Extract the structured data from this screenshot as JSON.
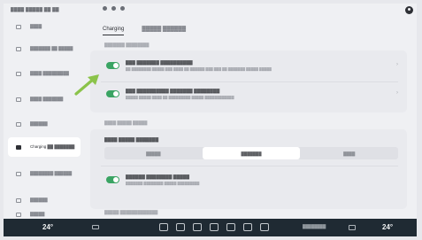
{
  "status_bar": {
    "left_text": "▓▓▓▓ ▓▓▓▓▓ ▓▓ ▓▓"
  },
  "sidebar": {
    "items": [
      {
        "label": "▓▓▓▓"
      },
      {
        "label": "▓▓▓▓▓▓▓ ▓▓ ▓▓▓▓▓"
      },
      {
        "label": "▓▓▓▓ ▓▓▓▓▓▓▓▓▓"
      },
      {
        "label": "▓▓▓▓ ▓▓▓▓▓▓▓"
      },
      {
        "label": "▓▓▓▓▓▓"
      },
      {
        "label": "Charging ▓▓ ▓▓▓▓▓▓▓"
      },
      {
        "label": "▓▓▓▓▓▓▓▓ ▓▓▓▓▓▓"
      },
      {
        "label": "▓▓▓▓▓▓"
      },
      {
        "label": "▓▓▓▓▓"
      }
    ],
    "active_index": 5
  },
  "tabs": [
    {
      "label": "Charging",
      "active": true
    },
    {
      "label": "▓▓▓▓▓ ▓▓▓▓▓▓",
      "active": false
    }
  ],
  "section1_label": "▓▓▓▓▓▓▓ ▓▓▓▓▓▓▓▓",
  "toggle_rows": [
    {
      "title": "▓▓▓ ▓▓▓▓▓▓▓ ▓▓▓▓▓▓▓▓▓▓",
      "subtitle": "▓▓ ▓▓▓▓▓▓▓▓ ▓▓▓▓▓ ▓▓▓ ▓▓▓▓ ▓▓ ▓▓▓▓▓▓ ▓▓▓ ▓▓▓ ▓▓ ▓▓▓▓▓▓▓ ▓▓▓▓▓ ▓▓▓▓▓",
      "on": true
    },
    {
      "title": "▓▓▓ ▓▓▓▓▓▓▓▓▓▓ ▓▓▓▓▓▓▓ ▓▓▓▓▓▓▓▓",
      "subtitle": "▓▓▓▓▓ ▓▓▓▓▓ ▓▓▓▓ ▓▓ ▓▓▓▓▓▓▓▓▓ ▓▓▓▓▓ ▓▓▓▓▓▓▓▓▓▓▓▓",
      "on": true
    }
  ],
  "section2_label": "▓▓▓▓ ▓▓▓▓▓ ▓▓▓▓▓",
  "seg_title": "▓▓▓▓ ▓▓▓▓▓ ▓▓▓▓▓▓▓",
  "seg_options": [
    {
      "label": "▓▓▓▓▓",
      "selected": false
    },
    {
      "label": "▓▓▓▓▓▓▓",
      "selected": true
    },
    {
      "label": "▓▓▓▓",
      "selected": false
    }
  ],
  "toggle_row3": {
    "title": "▓▓▓▓▓▓ ▓▓▓▓▓▓▓▓ ▓▓▓▓▓",
    "subtitle": "▓▓▓▓▓▓▓ ▓▓▓▓▓▓▓▓ ▓▓▓▓▓ ▓▓▓▓▓▓▓▓▓",
    "on": true
  },
  "footer_note": "▓▓▓▓▓ ▓▓▓▓▓▓▓▓▓▓▓▓▓",
  "dock": {
    "temp_left": "24°",
    "temp_right": "24°",
    "info_text": "▓▓▓▓▓▓▓▓"
  },
  "colors": {
    "accent_green": "#3aa463",
    "dock_bg": "#1f2a33",
    "arrow": "#8bc34a"
  }
}
